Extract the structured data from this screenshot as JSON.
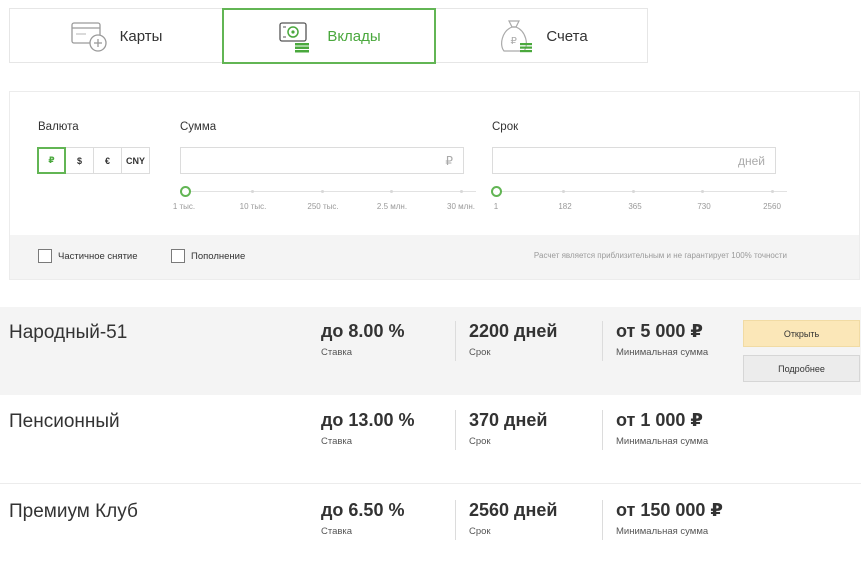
{
  "tabs": [
    {
      "label": "Карты",
      "icon": "card-icon",
      "active": false
    },
    {
      "label": "Вклады",
      "icon": "deposit-icon",
      "active": true
    },
    {
      "label": "Счета",
      "icon": "moneybag-icon",
      "active": false
    }
  ],
  "filters": {
    "currency_label": "Валюта",
    "currencies": [
      "₽",
      "$",
      "€",
      "CNY"
    ],
    "selected_currency": "₽",
    "amount_label": "Сумма",
    "amount_value": "",
    "amount_suffix": "₽",
    "amount_slider_value": "1 тыс.",
    "amount_ticks": [
      "1 тыс.",
      "10 тыс.",
      "250 тыс.",
      "2.5 млн.",
      "30 млн."
    ],
    "term_label": "Срок",
    "term_value": "",
    "term_suffix": "дней",
    "term_slider_value": "1",
    "term_ticks": [
      "1",
      "182",
      "365",
      "730",
      "2560"
    ],
    "partial_withdrawal_label": "Частичное снятие",
    "replenishment_label": "Пополнение",
    "partial_withdrawal_checked": false,
    "replenishment_checked": false,
    "disclaimer": "Расчет является приблизительным и не гарантирует 100% точности"
  },
  "deposits": [
    {
      "name": "Народный-51",
      "rate": "до 8.00 %",
      "rate_caption": "Ставка",
      "term": "2200 дней",
      "term_caption": "Срок",
      "min_sum": "от 5 000 ₽",
      "min_sum_caption": "Минимальная сумма",
      "open_label": "Открыть",
      "more_label": "Подробнее"
    },
    {
      "name": "Пенсионный",
      "rate": "до 13.00 %",
      "rate_caption": "Ставка",
      "term": "370 дней",
      "term_caption": "Срок",
      "min_sum": "от 1 000 ₽",
      "min_sum_caption": "Минимальная сумма"
    },
    {
      "name": "Премиум Клуб",
      "rate": "до 6.50 %",
      "rate_caption": "Ставка",
      "term": "2560 дней",
      "term_caption": "Срок",
      "min_sum": "от 150 000 ₽",
      "min_sum_caption": "Минимальная сумма"
    }
  ],
  "colors": {
    "accent_green": "#62b554",
    "open_button_bg": "#fbe7b8",
    "row_shade": "#f4f4f4"
  }
}
